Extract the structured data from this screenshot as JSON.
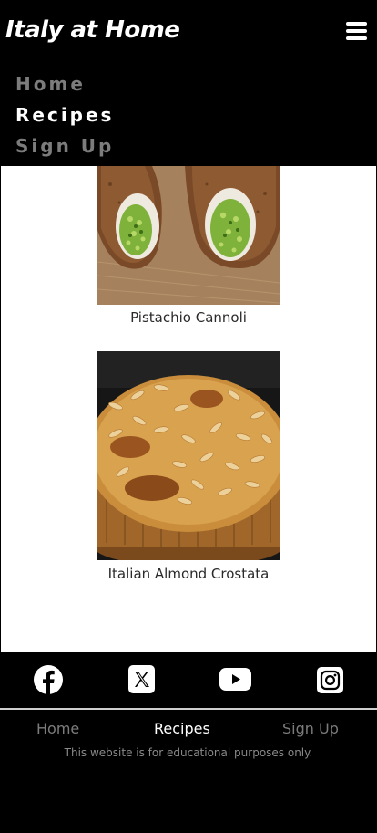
{
  "header": {
    "title": "Italy at Home",
    "menu_icon": "hamburger-menu-icon",
    "nav": [
      {
        "label": "Home",
        "active": false
      },
      {
        "label": "Recipes",
        "active": true
      },
      {
        "label": "Sign Up",
        "active": false
      }
    ]
  },
  "recipes": [
    {
      "caption": "Pistachio Cannoli",
      "image": "pistachio-cannoli-photo"
    },
    {
      "caption": "Italian Almond Crostata",
      "image": "almond-crostata-photo"
    }
  ],
  "footer": {
    "social": [
      "facebook-icon",
      "x-icon",
      "youtube-icon",
      "instagram-icon"
    ],
    "links": [
      {
        "label": "Home",
        "active": false
      },
      {
        "label": "Recipes",
        "active": true
      },
      {
        "label": "Sign Up",
        "active": false
      }
    ],
    "disclaimer": "This website is for educational purposes only."
  },
  "colors": {
    "background": "#000000",
    "content_background": "#ffffff",
    "active_text": "#ffffff",
    "inactive_text": "#7c7c7c"
  }
}
